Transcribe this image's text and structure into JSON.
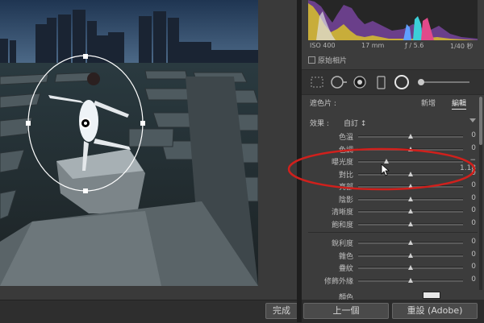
{
  "exif": {
    "iso": "ISO 400",
    "focal": "17 mm",
    "aperture": "ƒ / 5.6",
    "shutter": "1/40 秒"
  },
  "original_photo_label": "原始相片",
  "mask": {
    "label": "遮色片 :",
    "new_label": "新增",
    "edit_label": "編輯"
  },
  "effect": {
    "label": "效果 :",
    "value": "自訂 ↕"
  },
  "sliders_top": [
    {
      "name": "色溫",
      "value": "0",
      "position": 0.5
    },
    {
      "name": "色調",
      "value": "0",
      "position": 0.5
    },
    {
      "name": "曝光度",
      "value": "− 1.18",
      "position": 0.27
    },
    {
      "name": "對比",
      "value": "0",
      "position": 0.5
    },
    {
      "name": "亮部",
      "value": "0",
      "position": 0.5
    },
    {
      "name": "陰影",
      "value": "0",
      "position": 0.5
    },
    {
      "name": "清晰度",
      "value": "0",
      "position": 0.5
    },
    {
      "name": "飽和度",
      "value": "0",
      "position": 0.5
    }
  ],
  "sliders_bottom": [
    {
      "name": "銳利度",
      "value": "0",
      "position": 0.5
    },
    {
      "name": "雜色",
      "value": "0",
      "position": 0.5
    },
    {
      "name": "疊紋",
      "value": "0",
      "position": 0.5
    },
    {
      "name": "修飾外緣",
      "value": "0",
      "position": 0.5
    }
  ],
  "color_label": "顏色",
  "buttons": {
    "done": "完成",
    "previous": "上一個",
    "reset": "重設 (Adobe)"
  },
  "colors": {
    "annotation": "#d0201c",
    "panel": "#3c3c3c"
  }
}
